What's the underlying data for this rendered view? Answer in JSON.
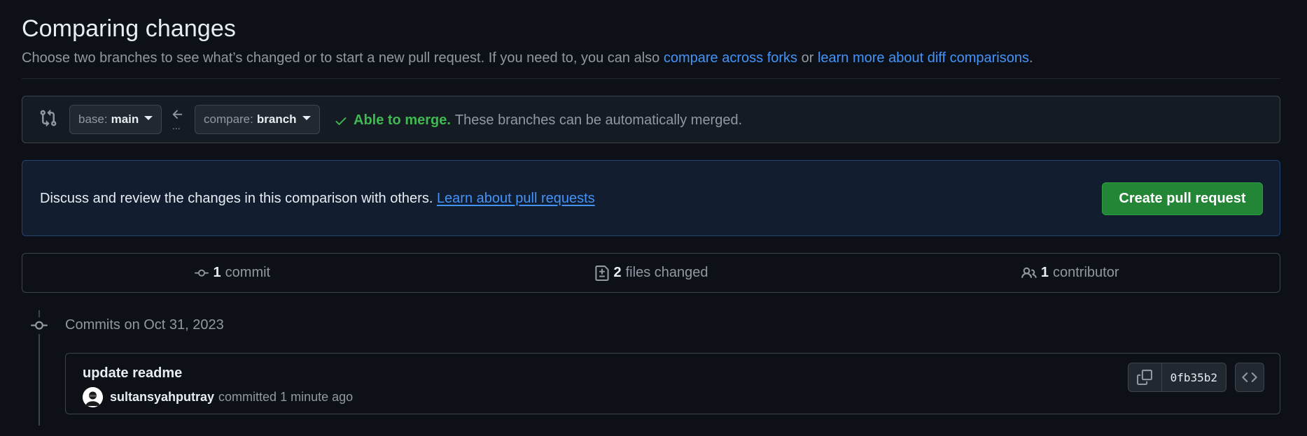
{
  "header": {
    "title": "Comparing changes",
    "subtitle_prefix": "Choose two branches to see what’s changed or to start a new pull request. If you need to, you can also ",
    "link_forks": "compare across forks",
    "subtitle_or": " or ",
    "link_diff": "learn more about diff comparisons",
    "subtitle_suffix": "."
  },
  "compare": {
    "base_prefix": "base:",
    "base_branch": "main",
    "compare_prefix": "compare:",
    "compare_branch": "branch",
    "arrow_dots": "...",
    "merge_status": "Able to merge.",
    "merge_description": "These branches can be automatically merged."
  },
  "discuss": {
    "text": "Discuss and review the changes in this comparison with others. ",
    "link": "Learn about pull requests",
    "button": "Create pull request"
  },
  "stats": {
    "commits_count": "1",
    "commits_label": "commit",
    "files_count": "2",
    "files_label": "files changed",
    "contributors_count": "1",
    "contributors_label": "contributor"
  },
  "timeline": {
    "date_heading": "Commits on Oct 31, 2023"
  },
  "commit": {
    "message": "update readme",
    "author": "sultansyahputray",
    "action": "committed",
    "time": "1 minute ago",
    "sha": "0fb35b2"
  },
  "icons": {
    "compare": "git-compare-icon",
    "arrow": "arrow-left-icon",
    "check": "check-icon",
    "commit": "git-commit-icon",
    "file_diff": "file-diff-icon",
    "people": "people-icon",
    "copy": "copy-icon",
    "code": "code-icon"
  },
  "colors": {
    "background": "#0d1117",
    "link": "#4493f8",
    "success": "#3fb950",
    "button_green": "#238636",
    "muted": "#9198a1"
  }
}
